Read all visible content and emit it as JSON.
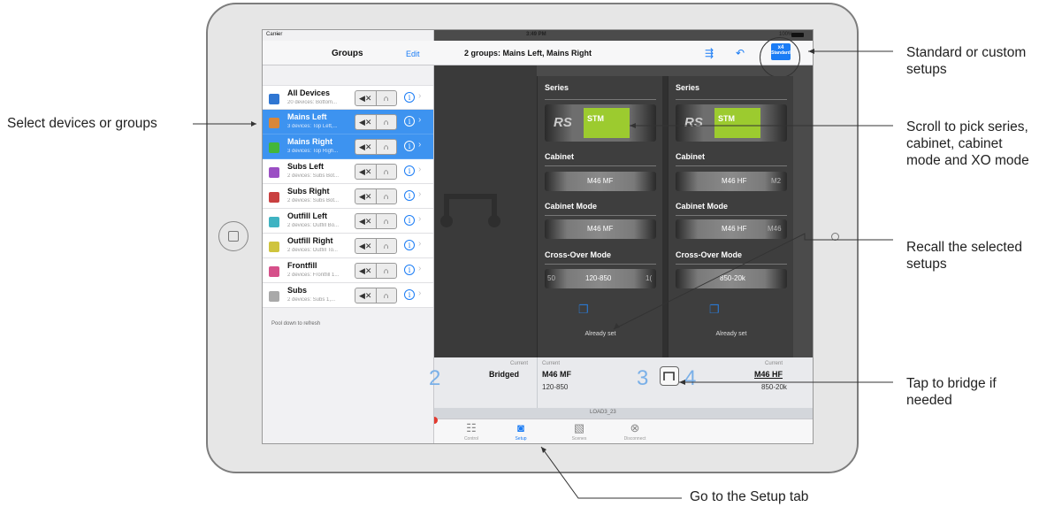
{
  "status": {
    "carrier": "Carrier",
    "time": "3:49 PM",
    "battery": "100%"
  },
  "left_panel": {
    "title": "Groups",
    "edit_label": "Edit",
    "groups": [
      {
        "name": "All Devices",
        "detail": "20 devices: Bottom...",
        "color": "#2f76d2",
        "selected": false
      },
      {
        "name": "Mains Left",
        "detail": "3 devices: Top Left,...",
        "color": "#d8873a",
        "selected": true
      },
      {
        "name": "Mains Right",
        "detail": "3 devices: Top Righ...",
        "color": "#43b63a",
        "selected": true
      },
      {
        "name": "Subs Left",
        "detail": "2 devices: Subs Bot...",
        "color": "#9b4fc4",
        "selected": false
      },
      {
        "name": "Subs Right",
        "detail": "2 devices: Subs Bot...",
        "color": "#c94040",
        "selected": false
      },
      {
        "name": "Outfill Left",
        "detail": "2 devices: Outfill Bo...",
        "color": "#3fb3c2",
        "selected": false
      },
      {
        "name": "Outfill Right",
        "detail": "2 devices: Outfill To...",
        "color": "#cfc43d",
        "selected": false
      },
      {
        "name": "Frontfill",
        "detail": "2 devices: Frontfill 1...",
        "color": "#d6508a",
        "selected": false
      },
      {
        "name": "Subs",
        "detail": "2 devices: Subs 1,...",
        "color": "#a9a9a9",
        "selected": false
      }
    ],
    "pull_hint": "Pool down to refresh"
  },
  "right_panel": {
    "title": "2 groups: Mains Left, Mains Right",
    "standard_badge": {
      "count": "x4",
      "label": "Standard"
    },
    "columns": [
      {
        "series_label": "Series",
        "series_logo_rs": "RS",
        "series_logo_stm": "STM",
        "cabinet_label": "Cabinet",
        "cabinet_value": "M46 MF",
        "cabinet_mode_label": "Cabinet Mode",
        "cabinet_mode_value": "M46 MF",
        "crossover_label": "Cross-Over Mode",
        "crossover_prev": "50",
        "crossover_value": "120-850",
        "crossover_next": "1(",
        "status": "Already set"
      },
      {
        "series_label": "Series",
        "series_logo_rs": "RS",
        "series_logo_stm": "STM",
        "cabinet_label": "Cabinet",
        "cabinet_value": "M46 HF",
        "cabinet_next": "M2",
        "cabinet_mode_label": "Cabinet Mode",
        "cabinet_mode_value": "M46 HF",
        "cabinet_mode_next": "M46",
        "crossover_label": "Cross-Over Mode",
        "crossover_value": "850-20k",
        "status": "Already set"
      }
    ],
    "current": {
      "left": {
        "label": "Current",
        "value": "Bridged",
        "num": "2"
      },
      "mid": {
        "label": "Current",
        "cabinet": "M46 MF",
        "range": "120-850",
        "num": "3"
      },
      "right": {
        "label": "Current",
        "cabinet": "M46 HF",
        "range": "850-20k",
        "num": "4"
      }
    },
    "device_name": "LOAD3_23"
  },
  "tabs": [
    {
      "label": "Control",
      "icon": "sliders-icon",
      "active": false
    },
    {
      "label": "Setup",
      "icon": "setup-icon",
      "active": true
    },
    {
      "label": "Scenes",
      "icon": "scenes-icon",
      "active": false
    },
    {
      "label": "Disconnect",
      "icon": "disconnect-icon",
      "active": false
    }
  ],
  "callouts": {
    "select_devices": "Select devices or groups",
    "standard_custom_1": "Standard or custom",
    "standard_custom_2": "setups",
    "scroll_1": "Scroll to pick series,",
    "scroll_2": "cabinet, cabinet",
    "scroll_3": "mode and XO mode",
    "recall_1": "Recall the selected",
    "recall_2": "setups",
    "bridge_1": "Tap to bridge if",
    "bridge_2": "needed",
    "setup_tab": "Go to the Setup tab"
  },
  "colors": {
    "accent": "#1a7cf5",
    "selected_row": "#3d93f0",
    "stm_green": "#9ccb2f"
  }
}
